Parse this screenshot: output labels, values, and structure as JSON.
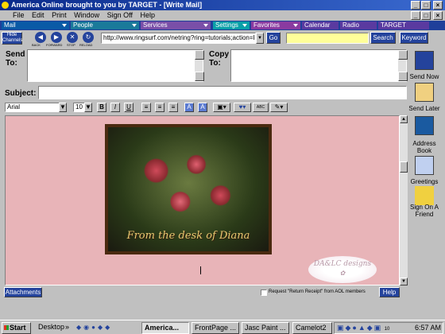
{
  "window": {
    "title": "America  Online brought to you by TARGET - [Write Mail]"
  },
  "menu": [
    "File",
    "Edit",
    "Print",
    "Window",
    "Sign Off",
    "Help"
  ],
  "channels": [
    {
      "label": "Mail"
    },
    {
      "label": "People"
    },
    {
      "label": "Services"
    },
    {
      "label": "Settings"
    },
    {
      "label": "Favorites"
    },
    {
      "label": "Calendar"
    },
    {
      "label": "Radio"
    },
    {
      "label": "TARGET"
    }
  ],
  "nav": {
    "hide_channels": "Hide Channels",
    "back": "BACK",
    "forward": "FORWARD",
    "stop": "STOP",
    "reload": "RELOAD",
    "url": "http://www.ringsurf.com/netring?ring=tutorials;action=lis",
    "go": "Go",
    "search_value": "",
    "search": "Search",
    "keyword": "Keyword"
  },
  "compose": {
    "send_to_label": "Send To:",
    "copy_to_label": "Copy To:",
    "subject_label": "Subject:",
    "send_to": "",
    "copy_to": "",
    "subject": ""
  },
  "format": {
    "font": "Arial",
    "size": "10",
    "bold": "B",
    "italic": "I",
    "underline": "U",
    "spell": "ABC"
  },
  "message": {
    "image_caption": "From the desk of Diana",
    "watermark": "DA&LC designs"
  },
  "side": [
    {
      "label": "Send Now",
      "icon": "send-now-icon"
    },
    {
      "label": "Send Later",
      "icon": "send-later-icon"
    },
    {
      "label": "Address Book",
      "icon": "address-book-icon"
    },
    {
      "label": "Greetings",
      "icon": "greetings-icon"
    },
    {
      "label": "Sign On A Friend",
      "icon": "sign-on-friend-icon"
    }
  ],
  "bottom": {
    "attachments": "Attachments",
    "receipt": "Request \"Return Receipt\" from AOL members",
    "help": "Help"
  },
  "taskbar": {
    "start": "Start",
    "desktop": "Desktop",
    "tasks": [
      "America...",
      "FrontPage ...",
      "Jasc Paint ...",
      "Camelot2"
    ],
    "clock": "6:57 AM",
    "tray_number": "10"
  },
  "colors": {
    "aol_blue": "#24439c",
    "mail_tab": "#0a5aa6",
    "people_tab": "#1a7a9a",
    "services_tab": "#7a4fa8",
    "settings_tab": "#0aa0a8",
    "favorites_tab": "#8a3aa0",
    "message_bg": "#e8b4b8"
  }
}
